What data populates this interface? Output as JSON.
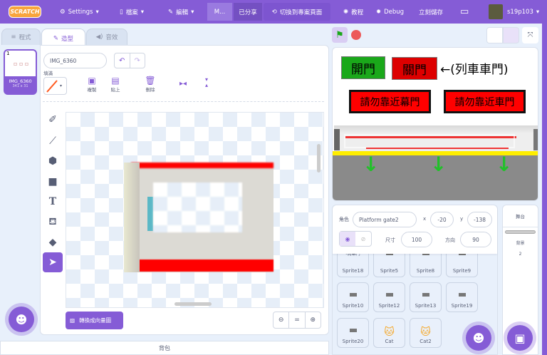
{
  "menu": {
    "logo": "SCRATCH",
    "settings": "Settings",
    "file": "檔案",
    "edit": "編輯",
    "project_title": "M...",
    "shared": "已分享",
    "see_project_page": "切換到專案頁面",
    "tutorials": "教程",
    "debug": "Debug",
    "save_now": "立刻儲存",
    "username": "s19p103"
  },
  "tabs": {
    "code": "程式",
    "costumes": "造型",
    "sounds": "音效"
  },
  "costume_list": [
    {
      "index": "1",
      "name": "IMG_6360",
      "size": "341 x 31"
    }
  ],
  "editor": {
    "costume_name": "IMG_6360",
    "fill_label": "填滿",
    "copy": "複製",
    "paste": "貼上",
    "delete": "刪除",
    "convert": "轉換成向量圖",
    "zoom_reset": "="
  },
  "backpack": "背包",
  "stage": {
    "open_door": "開門",
    "close_door": "關門",
    "train_doors_note": "←(列車車門)",
    "warn_platform": "請勿靠近幕門",
    "warn_train": "請勿靠近車門",
    "colors": {
      "green": "#1aa81a",
      "red": "#dd0000",
      "yellow": "#ffee00",
      "ground": "#8a8a8a"
    }
  },
  "sprite_info": {
    "sprite_label": "角色",
    "sprite_name": "Platform gate2",
    "x_label": "x",
    "x": "-20",
    "y_label": "y",
    "y": "-138",
    "size_label": "尺寸",
    "size": "100",
    "direction_label": "方向",
    "direction": "90"
  },
  "sprites": [
    {
      "name": "Sprite18",
      "top": "-開幕門"
    },
    {
      "name": "Sprite5"
    },
    {
      "name": "Sprite8"
    },
    {
      "name": "Sprite9"
    },
    {
      "name": "Sprite10"
    },
    {
      "name": "Sprite12"
    },
    {
      "name": "Sprite13"
    },
    {
      "name": "Sprite19"
    },
    {
      "name": "Sprite20"
    },
    {
      "name": "Cat"
    },
    {
      "name": "Cat2"
    }
  ],
  "stage_pane": {
    "title": "舞台",
    "backdrops_label": "背景",
    "backdrops_count": "2"
  }
}
